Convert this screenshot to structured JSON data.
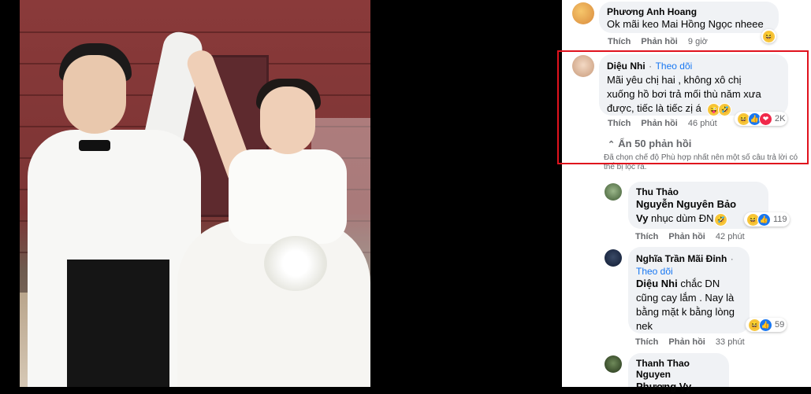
{
  "comments": [
    {
      "name": "Phương Anh Hoang",
      "text": "Ok mãi keo Mai Hồng Ngọc nheee",
      "like_label": "Thích",
      "reply_label": "Phản hồi",
      "time": "9 giờ"
    },
    {
      "name": "Diệu Nhi",
      "separator": "·",
      "follow_label": "Theo dõi",
      "text_lines": [
        "Mãi yêu chị hai , không xô chị",
        "xuống hồ bơi trả mối thù năm xưa",
        "được, tiếc là tiếc zị á"
      ],
      "like_label": "Thích",
      "reply_label": "Phản hồi",
      "time": "46 phút",
      "reaction_count": "2K",
      "hide_replies_label": "Ẩn 50 phản hồi",
      "filter_note": "Đã chọn chế độ Phù hợp nhất nên một số câu trả lời có thể bị lọc ra."
    }
  ],
  "replies": [
    {
      "name": "Thu Thảo",
      "mention": "Nguyễn Nguyên Bảo",
      "mention2": "Vy",
      "text": "nhục dùm ĐN",
      "like_label": "Thích",
      "reply_label": "Phản hồi",
      "time": "42 phút",
      "reaction_count": "119"
    },
    {
      "name": "Nghĩa Trần Mãi Đỉnh",
      "separator": "·",
      "follow_label": "Theo dõi",
      "mention": "Diệu Nhi",
      "text_lines": [
        "chắc DN",
        "cũng cay lắm . Nay là",
        "bằng mặt k bằng lòng",
        "nek"
      ],
      "like_label": "Thích",
      "reply_label": "Phản hồi",
      "time": "33 phút",
      "reaction_count": "59"
    },
    {
      "name": "Thanh Thao Nguyen",
      "mention": "Phương Vy"
    }
  ],
  "colors": {
    "highlight": "#e0121d",
    "link": "#1877f2",
    "bubble": "#f0f2f5"
  }
}
